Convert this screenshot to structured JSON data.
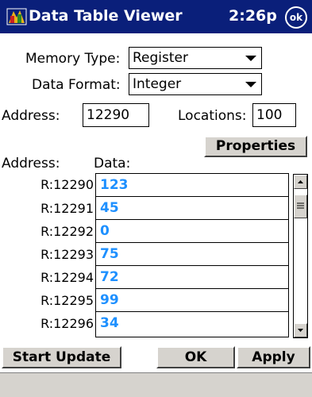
{
  "titlebar": {
    "app_title": "Data Table Viewer",
    "time": "2:26p",
    "ok_label": "ok"
  },
  "form": {
    "memory_type_label": "Memory Type:",
    "memory_type_value": "Register",
    "data_format_label": "Data Format:",
    "data_format_value": "Integer",
    "address_label": "Address:",
    "address_value": "12290",
    "locations_label": "Locations:",
    "locations_value": "100"
  },
  "buttons": {
    "properties": "Properties",
    "start_update": "Start Update",
    "ok": "OK",
    "apply": "Apply"
  },
  "table": {
    "address_header": "Address:",
    "data_header": "Data:",
    "rows": [
      {
        "address": "R:12290",
        "data": "123"
      },
      {
        "address": "R:12291",
        "data": "45"
      },
      {
        "address": "R:12292",
        "data": "0"
      },
      {
        "address": "R:12293",
        "data": "75"
      },
      {
        "address": "R:12294",
        "data": "72"
      },
      {
        "address": "R:12295",
        "data": "99"
      },
      {
        "address": "R:12296",
        "data": "34"
      }
    ]
  },
  "colors": {
    "title_bar": "#0A1F7A",
    "data_text": "#1E90FF",
    "button_face": "#D6D3CE",
    "footer": "#D6D3CE"
  }
}
